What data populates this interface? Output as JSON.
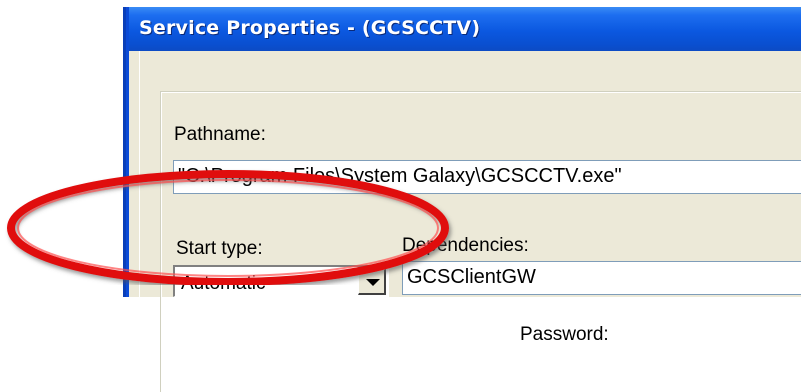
{
  "window": {
    "title": "Service Properties - (GCSCCTV)"
  },
  "form": {
    "pathname_label": "Pathname:",
    "pathname_value": "\"C:\\Program Files\\System Galaxy\\GCSCCTV.exe\"",
    "start_type_label": "Start type:",
    "start_type_value": "Automatic",
    "dependencies_label": "Dependencies:",
    "dependencies_value": "GCSClientGW",
    "password_label_partial": "Password:"
  },
  "annotation": {
    "highlight_color": "#e01010",
    "shape": "oval"
  }
}
